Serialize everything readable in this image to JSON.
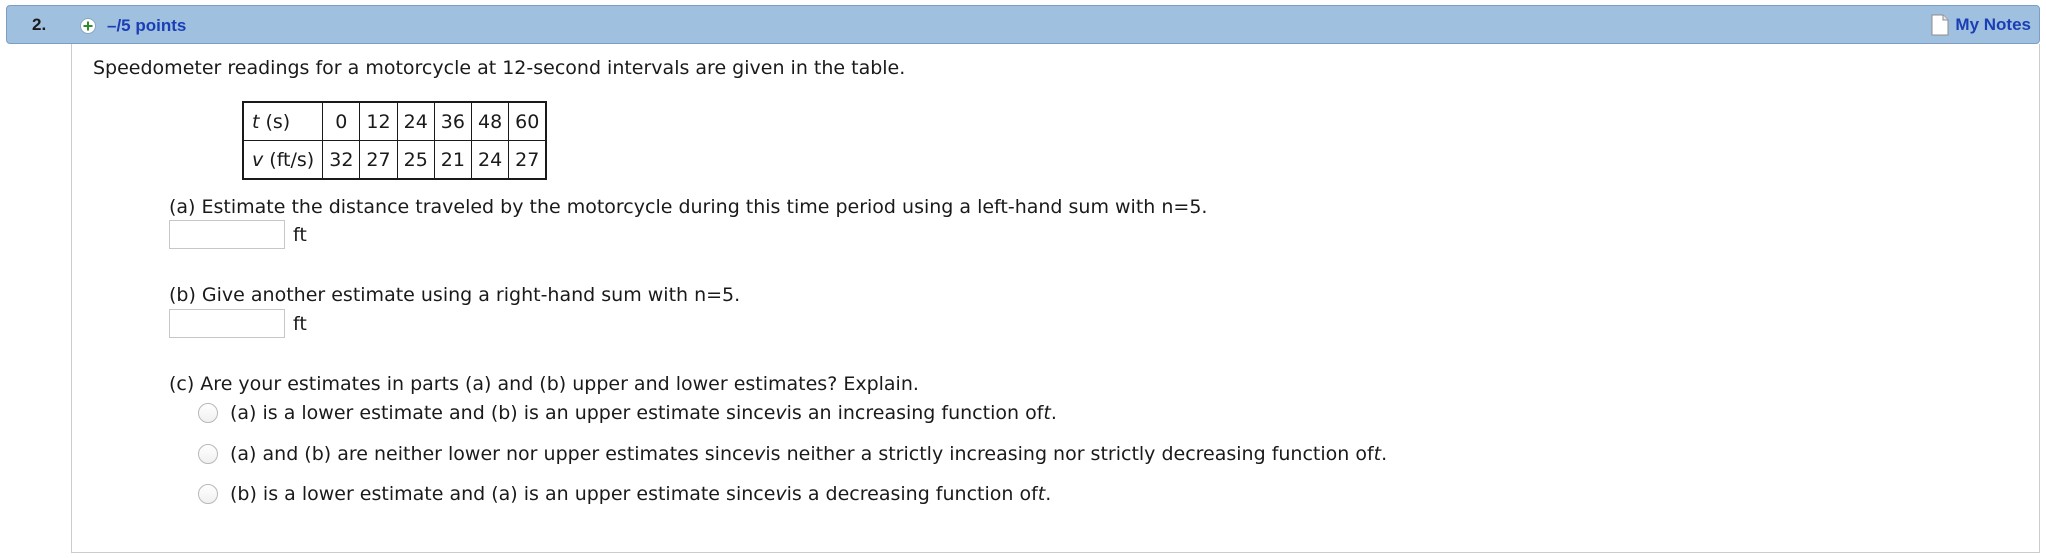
{
  "header": {
    "question_number": "2.",
    "points_label": "–/5 points",
    "notes_label": "My Notes",
    "accent_color": "#a0c0e0",
    "link_color": "#1a3fb5",
    "plus_icon": "plus-circle-icon",
    "notes_icon": "note-page-icon"
  },
  "prompt": "Speedometer readings for a motorcycle at 12-second intervals are given in the table.",
  "table": {
    "row1": {
      "var": "t",
      "unit": " (s)",
      "values": [
        "0",
        "12",
        "24",
        "36",
        "48",
        "60"
      ]
    },
    "row2": {
      "var": "v",
      "unit": " (ft/s)",
      "values": [
        "32",
        "27",
        "25",
        "21",
        "24",
        "27"
      ]
    }
  },
  "part_a": {
    "text": "(a) Estimate the distance traveled by the motorcycle during this time period using a left-hand sum with n=5.",
    "unit": "ft",
    "value": ""
  },
  "part_b": {
    "text": "(b) Give another estimate using a right-hand sum with n=5.",
    "unit": "ft",
    "value": ""
  },
  "part_c": {
    "text": "(c) Are your estimates in parts (a) and (b) upper and lower estimates? Explain.",
    "options": [
      {
        "pre": "(a) is a lower estimate and (b) is an upper estimate since ",
        "v": "v",
        "mid": " is an increasing function of ",
        "t": "t",
        "end": "."
      },
      {
        "pre": "(a) and (b) are neither lower nor upper estimates since ",
        "v": "v",
        "mid": " is neither a strictly increasing nor strictly decreasing function of ",
        "t": "t",
        "end": "."
      },
      {
        "pre": "(b) is a lower estimate and (a) is an upper estimate since ",
        "v": "v",
        "mid": " is a decreasing function of ",
        "t": "t",
        "end": "."
      }
    ]
  }
}
